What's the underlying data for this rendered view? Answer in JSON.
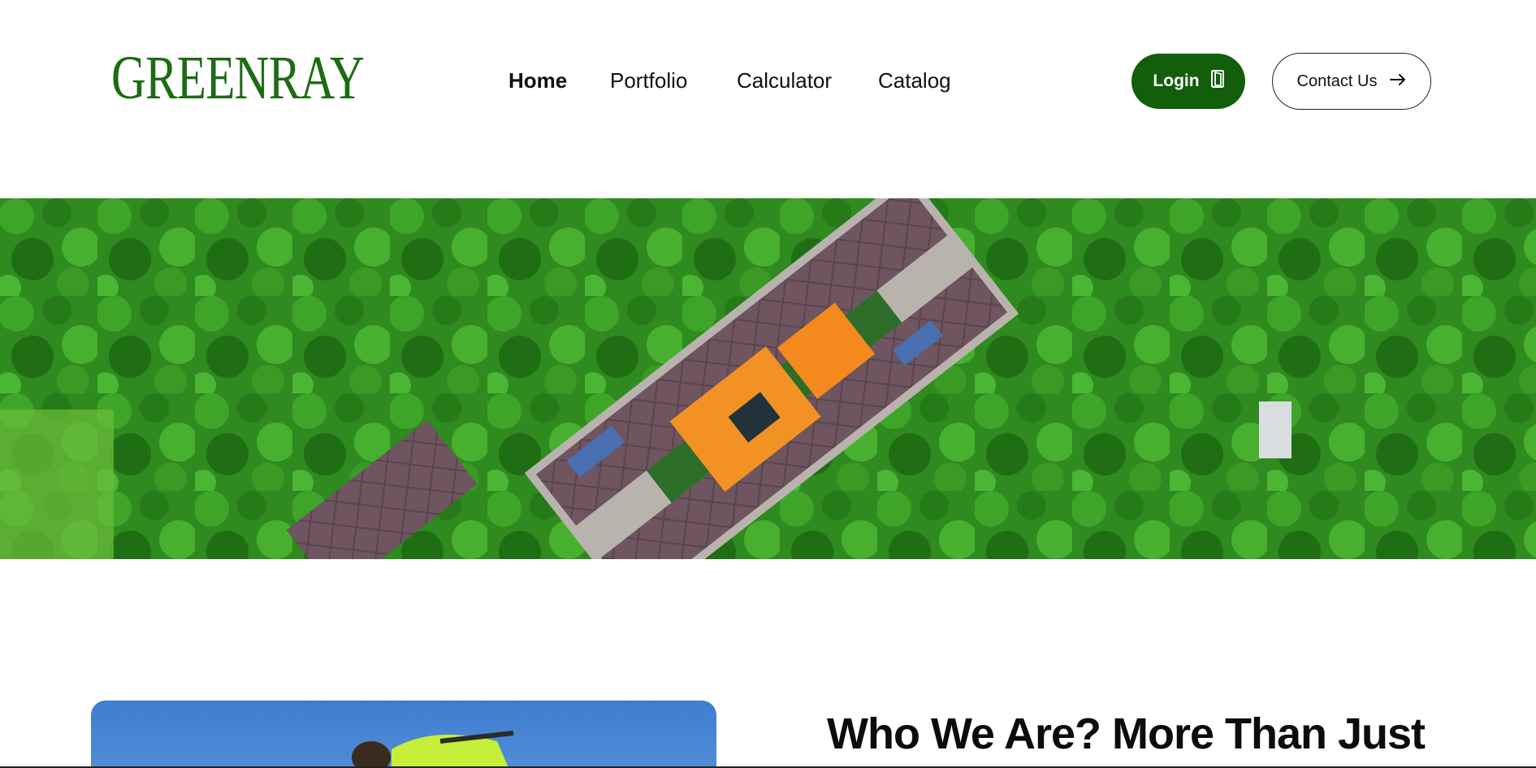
{
  "brand": {
    "logo_text": "GREENRAY",
    "color": "#1e6b14"
  },
  "nav": {
    "items": [
      {
        "label": "Home",
        "active": true
      },
      {
        "label": "Portfolio",
        "active": false
      },
      {
        "label": "Calculator",
        "active": false
      },
      {
        "label": "Catalog",
        "active": false
      }
    ]
  },
  "actions": {
    "login_label": "Login",
    "login_icon": "door-icon",
    "contact_label": "Contact Us",
    "contact_icon": "arrow-right-icon",
    "accent": "#125e0b"
  },
  "about": {
    "headline": "Who We Are? More Than Just"
  }
}
